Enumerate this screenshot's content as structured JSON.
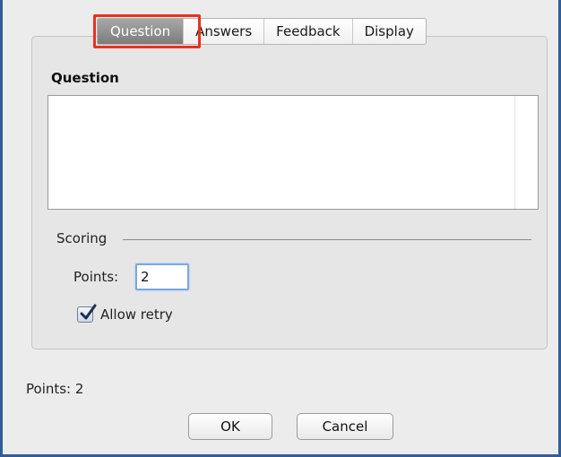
{
  "tabs": [
    {
      "label": "Question",
      "active": true
    },
    {
      "label": "Answers",
      "active": false
    },
    {
      "label": "Feedback",
      "active": false
    },
    {
      "label": "Display",
      "active": false
    }
  ],
  "question_section": {
    "heading": "Question",
    "text_value": ""
  },
  "scoring": {
    "legend": "Scoring",
    "points_label": "Points:",
    "points_value": "2",
    "allow_retry_label": "Allow retry",
    "allow_retry_checked": true
  },
  "status": {
    "points_summary": "Points: 2"
  },
  "buttons": {
    "ok_label": "OK",
    "cancel_label": "Cancel"
  },
  "colors": {
    "window_border": "#2f5e96",
    "highlight": "#e8321f",
    "active_tab": "#8e8e8e",
    "input_focus": "#7aa7e0"
  }
}
